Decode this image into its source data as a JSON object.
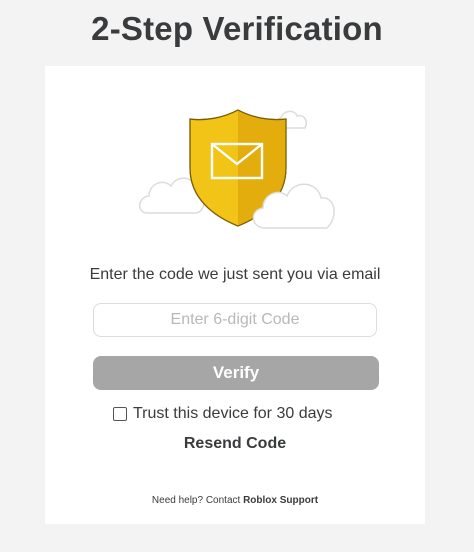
{
  "header": {
    "title": "2-Step Verification"
  },
  "illustration": {
    "icon": "shield-envelope-icon",
    "shield_color": "#f2c417",
    "shield_shade": "#e3ad0d",
    "cloud_icon": "cloud-icon"
  },
  "form": {
    "instruction": "Enter the code we just sent you via email",
    "code_placeholder": "Enter 6-digit Code",
    "code_value": "",
    "verify_label": "Verify",
    "verify_color": "#a6a6a6",
    "trust_label": "Trust this device for 30 days",
    "trust_checked": false,
    "resend_label": "Resend Code"
  },
  "footer": {
    "help_text": "Need help? Contact ",
    "support_link": "Roblox Support"
  }
}
